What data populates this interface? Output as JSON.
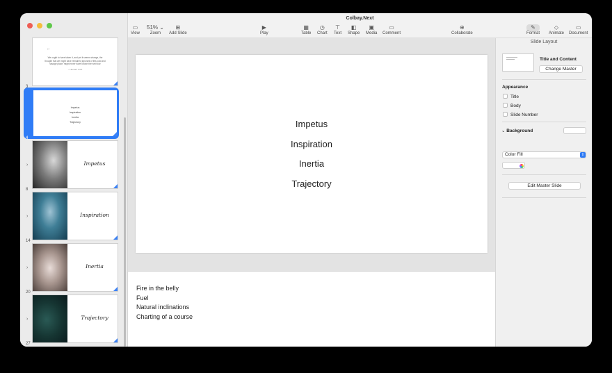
{
  "window": {
    "title": "Colbay.Next"
  },
  "toolbar": {
    "view": "View",
    "zoom": "51%",
    "zoom_label": "Zoom",
    "add_slide": "Add Slide",
    "play": "Play",
    "table": "Table",
    "chart": "Chart",
    "text": "Text",
    "shape": "Shape",
    "media": "Media",
    "comment": "Comment",
    "collaborate": "Collaborate",
    "format": "Format",
    "animate": "Animate",
    "document": "Document"
  },
  "navigator": {
    "slides": [
      {
        "number": "3",
        "quote": "We ought to have taken it, and yet it seems strange, the thought that we might have remained ignorant of this cold and savage place, might never have known the wet floor",
        "attribution": "~ Hannah Croft"
      },
      {
        "number": "4",
        "lines": [
          "Impetus",
          "Inspiration",
          "Inertia",
          "Trajectory"
        ]
      },
      {
        "number": "8",
        "script": "Impetus"
      },
      {
        "number": "14",
        "script": "Inspiration"
      },
      {
        "number": "20",
        "script": "Inertia"
      },
      {
        "number": "27",
        "script": "Trajectory"
      }
    ]
  },
  "slide": {
    "lines": [
      "Impetus",
      "Inspiration",
      "Inertia",
      "Trajectory"
    ]
  },
  "notes": {
    "lines": [
      "Fire in the belly",
      "Fuel",
      "Natural inclinations",
      "Charting of a course"
    ]
  },
  "inspector": {
    "header": "Slide Layout",
    "layout_name": "Title and Content",
    "change_master": "Change Master",
    "appearance": "Appearance",
    "checkboxes": [
      "Title",
      "Body",
      "Slide Number"
    ],
    "background": "Background",
    "fill_type": "Color Fill",
    "edit_master": "Edit Master Slide"
  },
  "colors": {
    "accent": "#2f7cf6"
  }
}
